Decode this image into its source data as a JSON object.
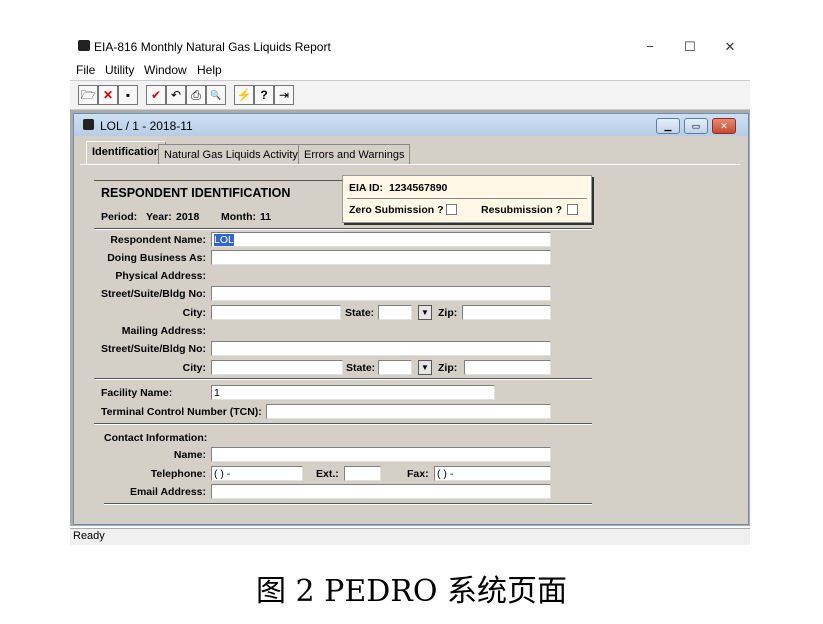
{
  "window": {
    "title": "EIA-816  Monthly Natural Gas Liquids Report",
    "minimize": "−",
    "maximize": "☐",
    "close": "✕"
  },
  "menu": [
    {
      "label": "File"
    },
    {
      "label": "Utility"
    },
    {
      "label": "Window"
    },
    {
      "label": "Help"
    }
  ],
  "toolbar": [
    {
      "icon": "open-folder-icon",
      "glyph": "🗁"
    },
    {
      "icon": "delete-icon",
      "glyph": "✕"
    },
    {
      "icon": "save-icon",
      "glyph": "▪"
    },
    {
      "icon": "check-icon",
      "glyph": "✔"
    },
    {
      "icon": "undo-icon",
      "glyph": "↶"
    },
    {
      "icon": "print-icon",
      "glyph": "⎙"
    },
    {
      "icon": "print-preview-icon",
      "glyph": "🔍"
    },
    {
      "icon": "submit-icon",
      "glyph": "⚡"
    },
    {
      "icon": "help-icon",
      "glyph": "?"
    },
    {
      "icon": "exit-icon",
      "glyph": "⇥"
    }
  ],
  "child_window": {
    "title": "LOL / 1 - 2018-11"
  },
  "tabs": [
    {
      "label": "Identification",
      "active": true
    },
    {
      "label": "Natural Gas Liquids Activity",
      "active": false
    },
    {
      "label": "Errors and Warnings",
      "active": false
    }
  ],
  "form": {
    "section_title": "RESPONDENT IDENTIFICATION",
    "period_label": "Period:",
    "year_label": "Year:",
    "year_value": "2018",
    "month_label": "Month:",
    "month_value": "11",
    "eia_id_label": "EIA ID:",
    "eia_id_value": "1234567890",
    "zero_submission_label": "Zero Submission ?",
    "resubmission_label": "Resubmission ?",
    "respondent_name_label": "Respondent Name:",
    "respondent_name_value": "LOL",
    "doing_business_as_label": "Doing Business As:",
    "physical_address_label": "Physical Address:",
    "street_label": "Street/Suite/Bldg No:",
    "city_label": "City:",
    "state_label": "State:",
    "zip_label": "Zip:",
    "mailing_address_label": "Mailing Address:",
    "facility_name_label": "Facility Name:",
    "facility_name_value": "1",
    "tcn_label": "Terminal Control Number (TCN):",
    "contact_info_label": "Contact Information:",
    "name_label": "Name:",
    "telephone_label": "Telephone:",
    "telephone_value": "(  )   -",
    "ext_label": "Ext.:",
    "fax_label": "Fax:",
    "fax_value": "(  )   -",
    "email_label": "Email Address:"
  },
  "status": {
    "text": "Ready"
  },
  "caption": "图 2 PEDRO  系统页面"
}
